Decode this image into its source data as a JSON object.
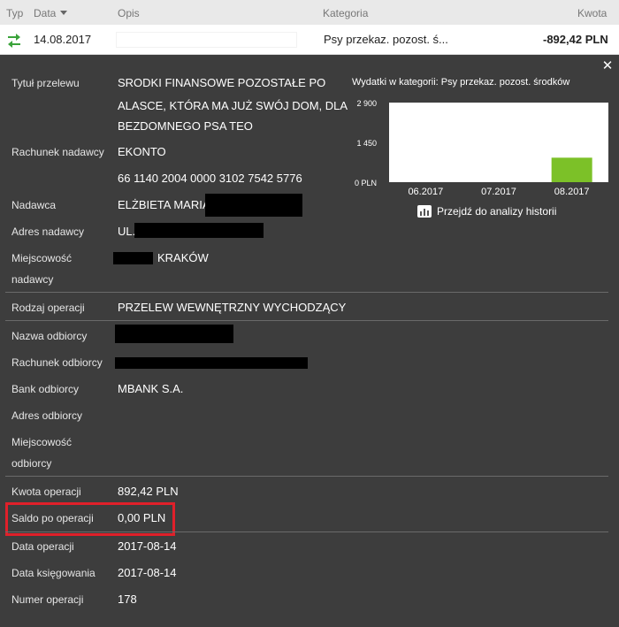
{
  "header": {
    "typ": "Typ",
    "data": "Data",
    "opis": "Opis",
    "kategoria": "Kategoria",
    "kwota": "Kwota"
  },
  "row": {
    "date": "14.08.2017",
    "category": "Psy przekaz. pozost. ś...",
    "amount": "-892,42 PLN"
  },
  "details": {
    "tytul_label": "Tytuł przelewu",
    "tytul_lines": [
      "SRODKI FINANSOWE POZOSTAŁE PO",
      "ALASCE, KTÓRA MA JUŻ SWÓJ DOM, DLA",
      "BEZDOMNEGO PSA TEO"
    ],
    "rachunek_nadawcy_label": "Rachunek nadawcy",
    "rachunek_nadawcy_lines": [
      "EKONTO",
      "66 1140 2004 0000 3102 7542 5776"
    ],
    "nadawca_label": "Nadawca",
    "nadawca_value": "ELŻBIETA MARIA",
    "adres_nadawcy_label": "Adres nadawcy",
    "adres_nadawcy_value": "UL.",
    "miejscowosc_nadawcy_label": [
      "Miejscowość",
      "nadawcy"
    ],
    "miejscowosc_nadawcy_value": "KRAKÓW",
    "rodzaj_label": "Rodzaj operacji",
    "rodzaj_value": "PRZELEW WEWNĘTRZNY WYCHODZĄCY",
    "nazwa_odbiorcy_label": "Nazwa odbiorcy",
    "rachunek_odbiorcy_label": "Rachunek odbiorcy",
    "bank_odbiorcy_label": "Bank odbiorcy",
    "bank_odbiorcy_value": "MBANK S.A.",
    "adres_odbiorcy_label": "Adres odbiorcy",
    "miejscowosc_odbiorcy_label": [
      "Miejscowość",
      "odbiorcy"
    ],
    "kwota_label": "Kwota operacji",
    "kwota_value": "892,42 PLN",
    "saldo_label": "Saldo po operacji",
    "saldo_value": "0,00 PLN",
    "data_operacji_label": "Data operacji",
    "data_operacji_value": "2017-08-14",
    "data_ksiegowania_label": "Data księgowania",
    "data_ksiegowania_value": "2017-08-14",
    "numer_label": "Numer operacji",
    "numer_value": "178"
  },
  "chart": {
    "title": "Wydatki w kategorii:  Psy przekaz. pozost. środków",
    "history_link": "Przejdź do analizy historii"
  },
  "chart_data": {
    "type": "bar",
    "categories": [
      "06.2017",
      "07.2017",
      "08.2017"
    ],
    "values": [
      0,
      0,
      892.42
    ],
    "ytick_labels": [
      "0 PLN",
      "1 450",
      "2 900"
    ],
    "yticks": [
      0,
      1450,
      2900
    ],
    "ylim": [
      0,
      2900
    ],
    "bar_color": "#7cc128",
    "plot_bg": "#ffffff"
  },
  "colors": {
    "header_bg": "#e9e9e9",
    "panel_bg": "#3d3d3d",
    "highlight": "#e0202a",
    "transfer_icon": "#3aa33a"
  },
  "icons": {
    "transfer": "transfer-arrows-icon",
    "close": "close-icon",
    "history": "bar-chart-icon"
  }
}
